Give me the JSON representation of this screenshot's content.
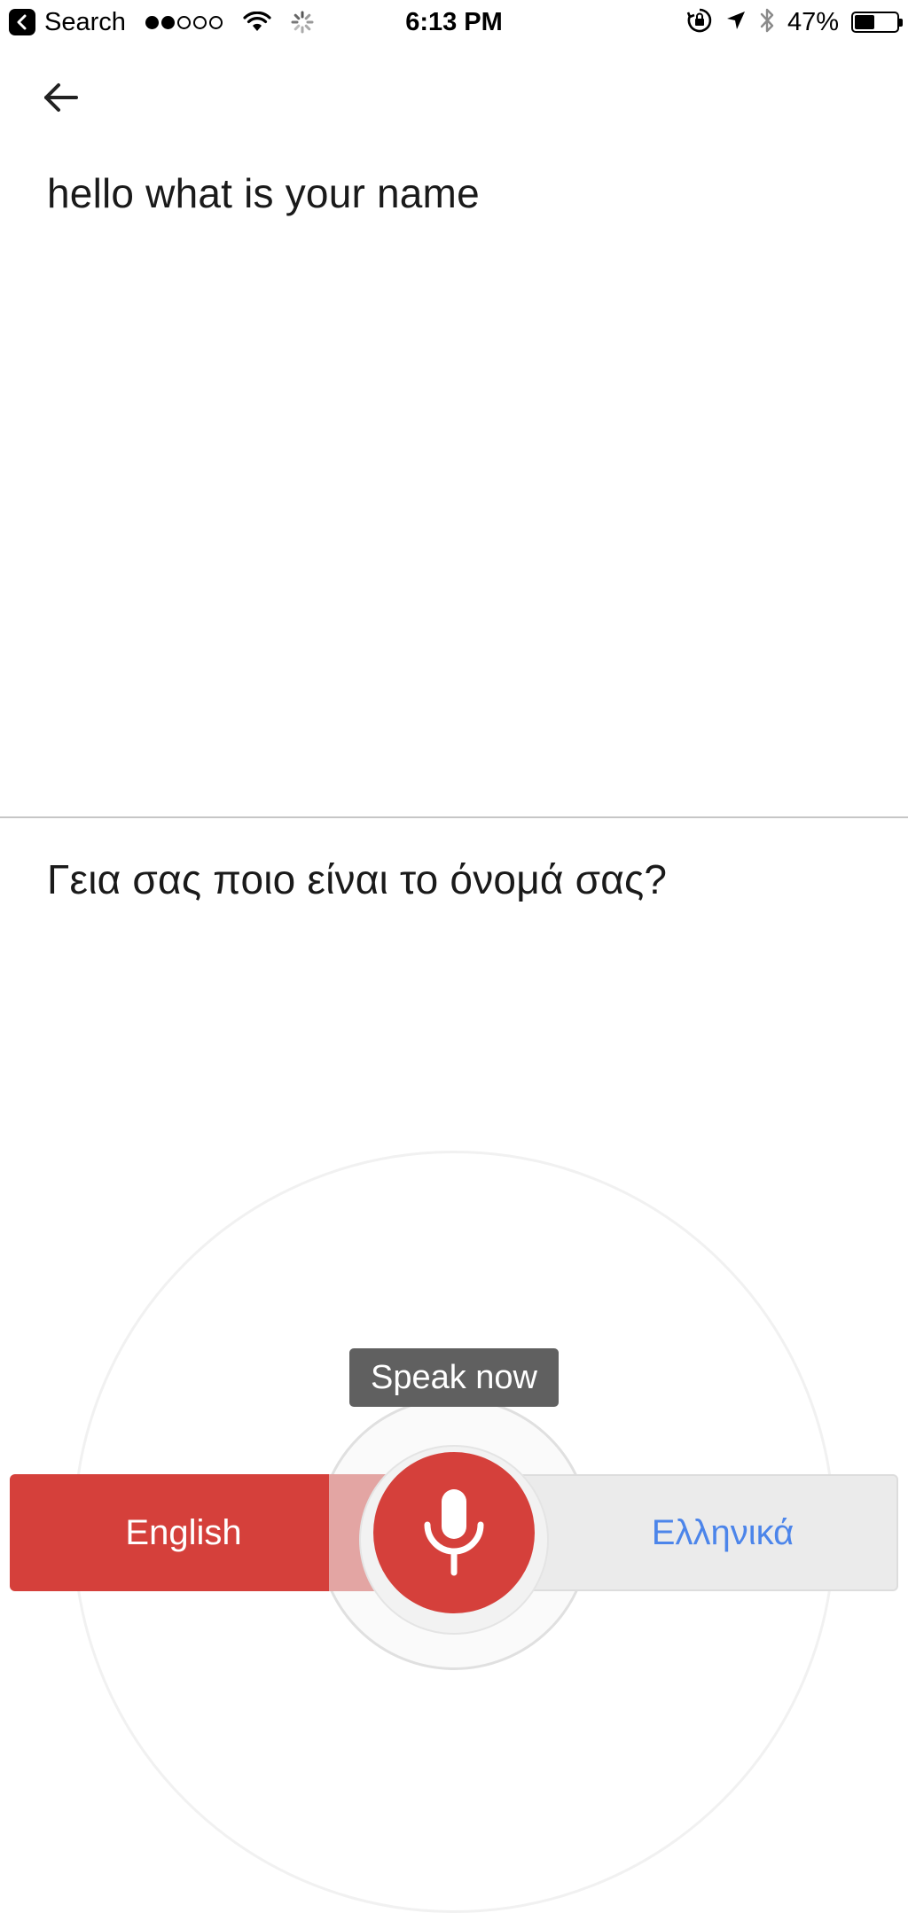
{
  "status_bar": {
    "back_app_label": "Search",
    "time": "6:13 PM",
    "battery_percent": "47%",
    "battery_level": 0.47,
    "signal_bars_filled": 2,
    "signal_bars_total": 5,
    "icons": [
      "back-to-app-icon",
      "signal-icon",
      "wifi-icon",
      "activity-spinner-icon",
      "orientation-lock-icon",
      "location-arrow-icon",
      "bluetooth-icon",
      "battery-icon"
    ]
  },
  "header": {
    "back_icon": "arrow-left-icon"
  },
  "source": {
    "text": "hello what is your name"
  },
  "translation": {
    "text": "Γεια σας ποιο είναι το όνομά σας?"
  },
  "tooltip": {
    "text": "Speak now"
  },
  "language_bar": {
    "source_language": "English",
    "target_language": "Ελληνικά",
    "mic_icon": "microphone-icon",
    "colors": {
      "active": "#d5403b",
      "inactive_bg": "#ebebeb",
      "target_label": "#4c85ea"
    }
  }
}
